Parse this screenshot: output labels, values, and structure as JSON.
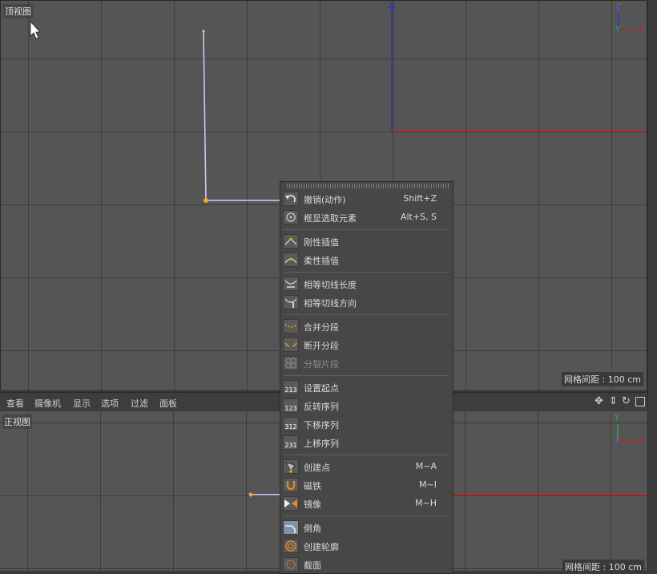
{
  "top_view": {
    "label": "顶视图",
    "grid_note": "网格间距 : 100 cm"
  },
  "front_view": {
    "label": "正视图",
    "grid_note": "网格间距 : 100 cm"
  },
  "top_axes": {
    "z": "Z",
    "y": "Y",
    "x": "X"
  },
  "front_axes": {
    "y": "Y",
    "z": "Z",
    "x": "X"
  },
  "menubar": {
    "items": [
      "查看",
      "摄像机",
      "显示",
      "选项",
      "过滤",
      "面板"
    ]
  },
  "colors": {
    "x_axis": "#cc2020",
    "y_axis": "#30c030",
    "z_axis": "#2a2ad0",
    "spline": "#c8d2ff",
    "point": "#f5a623"
  },
  "context_menu": {
    "items": [
      {
        "label": "撤销(动作)",
        "shortcut": "Shift+Z",
        "icon": "undo-icon"
      },
      {
        "label": "框显选取元素",
        "shortcut": "Alt+S, S",
        "icon": "frame-selection-icon"
      },
      {
        "label": "刚性插值",
        "shortcut": "",
        "icon": "hard-interpolation-icon"
      },
      {
        "label": "柔性插值",
        "shortcut": "",
        "icon": "soft-interpolation-icon"
      },
      {
        "label": "相等切线长度",
        "shortcut": "",
        "icon": "equal-tangent-length-icon"
      },
      {
        "label": "相等切线方向",
        "shortcut": "",
        "icon": "equal-tangent-direction-icon"
      },
      {
        "label": "合并分段",
        "shortcut": "",
        "icon": "join-segment-icon"
      },
      {
        "label": "断开分段",
        "shortcut": "",
        "icon": "break-segment-icon"
      },
      {
        "label": "分裂片段",
        "shortcut": "",
        "icon": "explode-segments-icon",
        "disabled": true
      },
      {
        "label": "设置起点",
        "shortcut": "",
        "icon": "set-first-point-icon",
        "icon_text": "213"
      },
      {
        "label": "反转序列",
        "shortcut": "",
        "icon": "reverse-sequence-icon",
        "icon_text": "123"
      },
      {
        "label": "下移序列",
        "shortcut": "",
        "icon": "move-down-sequence-icon",
        "icon_text": "312"
      },
      {
        "label": "上移序列",
        "shortcut": "",
        "icon": "move-up-sequence-icon",
        "icon_text": "231"
      },
      {
        "label": "创建点",
        "shortcut": "M~A",
        "icon": "create-point-icon"
      },
      {
        "label": "磁铁",
        "shortcut": "M~I",
        "icon": "magnet-icon"
      },
      {
        "label": "镜像",
        "shortcut": "M~H",
        "icon": "mirror-icon"
      },
      {
        "label": "倒角",
        "shortcut": "",
        "icon": "chamfer-icon"
      },
      {
        "label": "创建轮廓",
        "shortcut": "",
        "icon": "create-outline-icon"
      },
      {
        "label": "截面",
        "shortcut": "",
        "icon": "cross-section-icon"
      }
    ]
  }
}
